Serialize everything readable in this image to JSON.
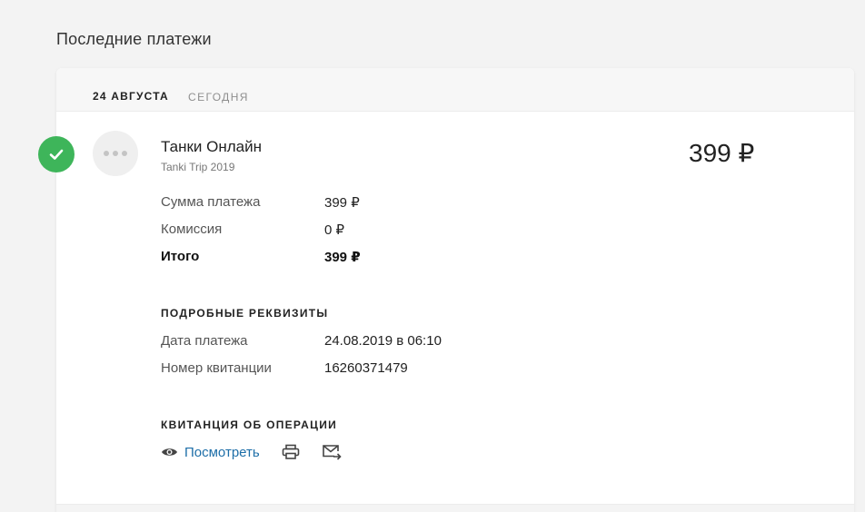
{
  "page": {
    "title": "Последние платежи"
  },
  "group": {
    "date": "24 АВГУСТА",
    "relative": "СЕГОДНЯ"
  },
  "payment": {
    "merchant": "Танки Онлайн",
    "description": "Tanki Trip 2019",
    "amount": "399 ₽",
    "status": "success",
    "summary": [
      {
        "label": "Сумма платежа",
        "value": "399 ₽"
      },
      {
        "label": "Комиссия",
        "value": "0 ₽"
      },
      {
        "label": "Итого",
        "value": "399 ₽"
      }
    ],
    "details_title": "ПОДРОБНЫЕ РЕКВИЗИТЫ",
    "details": [
      {
        "label": "Дата платежа",
        "value": "24.08.2019 в 06:10"
      },
      {
        "label": "Номер квитанции",
        "value": "16260371479"
      }
    ],
    "receipt_title": "КВИТАНЦИЯ ОБ ОПЕРАЦИИ",
    "receipt_actions": {
      "view_label": "Посмотреть"
    }
  },
  "colors": {
    "success": "#3eb55a",
    "link": "#1d6ea8",
    "background": "#f3f3f3"
  },
  "icons": [
    "check-icon",
    "more-dots-icon",
    "eye-icon",
    "print-icon",
    "email-forward-icon"
  ]
}
